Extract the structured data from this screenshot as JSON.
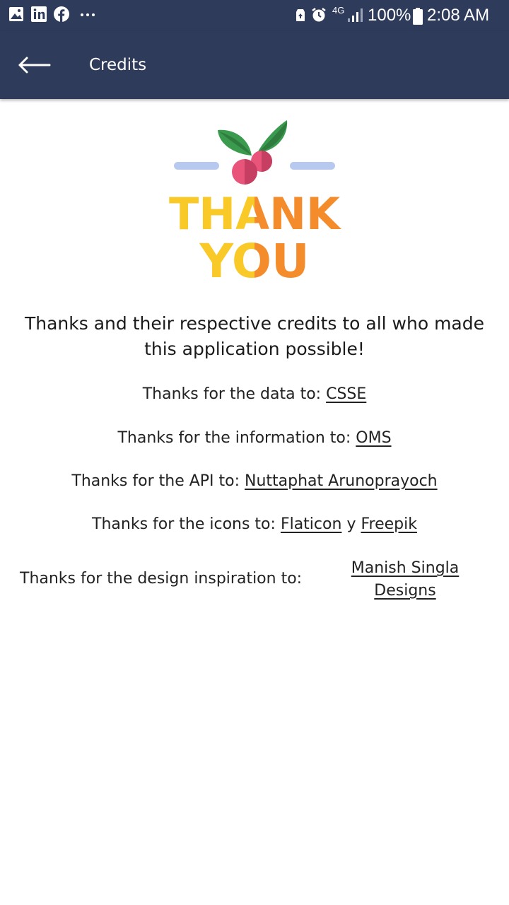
{
  "status_bar": {
    "network": "4G",
    "battery": "100%",
    "time": "2:08 AM",
    "left_icons": [
      "gallery-icon",
      "linkedin-icon",
      "facebook-icon",
      "more-dots-icon"
    ],
    "right_icons": [
      "recycle-icon",
      "alarm-icon",
      "signal-icon",
      "battery-icon"
    ]
  },
  "app_bar": {
    "title": "Credits",
    "back_icon": "arrow-left-icon"
  },
  "hero": {
    "line1": "THANK",
    "line2": "YOU"
  },
  "intro": "Thanks and their respective credits to all who made this application possible!",
  "credits": [
    {
      "label": "Thanks for the data to:",
      "link": "CSSE"
    },
    {
      "label": "Thanks for the information to:",
      "link": "OMS"
    },
    {
      "label": "Thanks for the API to:",
      "link": "Nuttaphat Arunoprayoch"
    },
    {
      "label": "Thanks for the icons to:",
      "link": "Flaticon",
      "separator": "y",
      "link2": "Freepik"
    },
    {
      "label": "Thanks for the design inspiration to:",
      "link_line1": "Manish Singla",
      "link_line2": "Designs"
    }
  ],
  "colors": {
    "app_bar": "#2f3b5b",
    "thank_yellow": "#f9c928",
    "thank_orange": "#f58c2c",
    "leaf_green": "#3a9a4d",
    "berry_pink": "#e8547a",
    "bar_blue": "#b7c9ee"
  }
}
